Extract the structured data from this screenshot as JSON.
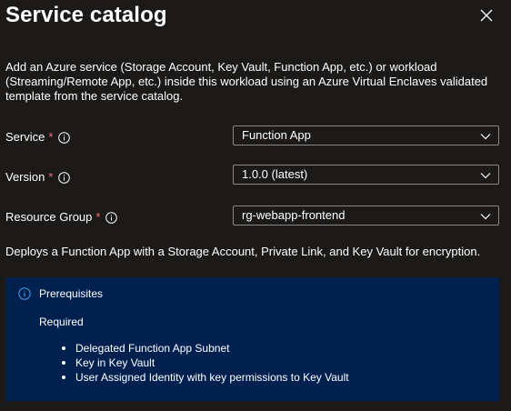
{
  "panel": {
    "title": "Service catalog",
    "description": "Add an Azure service (Storage Account, Key Vault, Function App, etc.) or workload (Streaming/Remote App, etc.) inside this workload using an Azure Virtual Enclaves validated template from the service catalog."
  },
  "form": {
    "required_marker": "*",
    "service": {
      "label": "Service",
      "value": "Function App"
    },
    "version": {
      "label": "Version",
      "value": "1.0.0 (latest)"
    },
    "resource_group": {
      "label": "Resource Group",
      "value": "rg-webapp-frontend"
    }
  },
  "deploy_description": "Deploys a Function App with a Storage Account, Private Link, and Key Vault for encryption.",
  "prerequisites": {
    "title": "Prerequisites",
    "subtitle": "Required",
    "items": [
      "Delegated Function App Subnet",
      "Key in Key Vault",
      "User Assigned Identity with key permissions to Key Vault"
    ]
  },
  "icons": {
    "close": "close-icon",
    "info": "info-icon",
    "chevron": "chevron-down-icon"
  },
  "colors": {
    "background": "#1b1a19",
    "required": "#f1707b",
    "info_box_bg": "#002050",
    "info_icon": "#4f9fef",
    "border": "#8a8886"
  }
}
